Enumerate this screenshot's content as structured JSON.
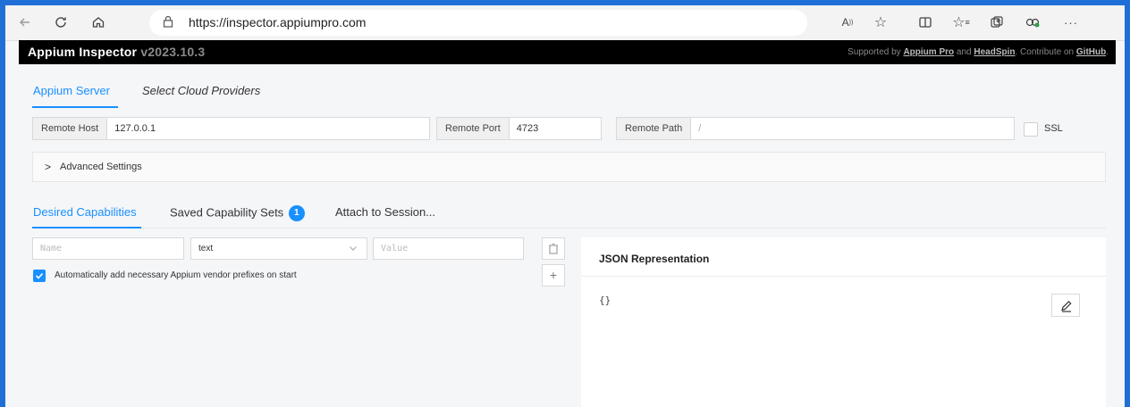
{
  "browser": {
    "url": "https://inspector.appiumpro.com",
    "icons": [
      "back-arrow-icon",
      "refresh-icon",
      "home-icon",
      "lock-icon",
      "read-aloud-icon",
      "favorite-star-icon",
      "split-screen-icon",
      "favorites-list-icon",
      "collections-icon",
      "extensions-icon",
      "more-icon"
    ]
  },
  "app": {
    "title": "Appium Inspector",
    "version": "v2023.10.3",
    "support_prefix": "Supported by",
    "support_appium_pro": "Appium Pro",
    "support_and": "and",
    "support_headspin": "HeadSpin",
    "support_contribute": ". Contribute on",
    "support_github": "GitHub",
    "support_end": "."
  },
  "server_tabs": {
    "appium_server": "Appium Server",
    "cloud_providers": "Select Cloud Providers"
  },
  "server_fields": {
    "remote_host_label": "Remote Host",
    "remote_host_value": "127.0.0.1",
    "remote_port_label": "Remote Port",
    "remote_port_value": "4723",
    "remote_path_label": "Remote Path",
    "remote_path_placeholder": "/",
    "ssl_label": "SSL"
  },
  "advanced": {
    "label": "Advanced Settings"
  },
  "cap_tabs": {
    "desired": "Desired Capabilities",
    "saved": "Saved Capability Sets",
    "saved_count": "1",
    "attach": "Attach to Session..."
  },
  "capability_row": {
    "name_placeholder": "Name",
    "type_value": "text",
    "value_placeholder": "Value"
  },
  "vendor_prefix": {
    "label": "Automatically add necessary Appium vendor prefixes on start",
    "checked": true
  },
  "json": {
    "title": "JSON Representation",
    "body": "{}"
  },
  "colors": {
    "accent": "#1890ff",
    "frame": "#1f6fd6",
    "header_bg": "#000000"
  }
}
